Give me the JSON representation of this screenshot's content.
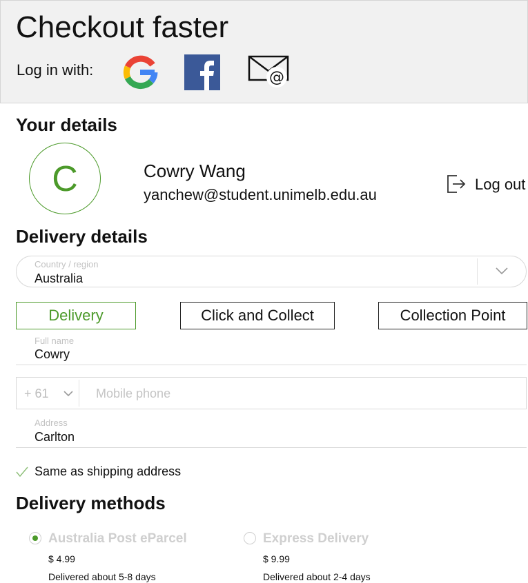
{
  "header": {
    "title": "Checkout faster",
    "login_label": "Log in with:",
    "providers": [
      {
        "name": "Google",
        "icon": "google-icon"
      },
      {
        "name": "Facebook",
        "icon": "facebook-icon"
      },
      {
        "name": "Email",
        "icon": "email-icon"
      }
    ]
  },
  "your_details": {
    "heading": "Your details",
    "avatar_initial": "C",
    "name": "Cowry Wang",
    "email": "yanchew@student.unimelb.edu.au",
    "logout_label": "Log out",
    "logout_icon": "logout-icon"
  },
  "delivery_details": {
    "heading": "Delivery details",
    "country": {
      "label": "Country / region",
      "value": "Australia",
      "icon": "chevron-down-icon"
    },
    "tabs": [
      {
        "label": "Delivery",
        "active": true
      },
      {
        "label": "Click and Collect",
        "active": false
      },
      {
        "label": "Collection Point",
        "active": false
      }
    ],
    "full_name": {
      "label": "Full name",
      "value": "Cowry"
    },
    "phone": {
      "country_code": "+ 61",
      "placeholder": "Mobile phone"
    },
    "address": {
      "label": "Address",
      "value": "Carlton"
    },
    "same_as_shipping": {
      "label": "Same as shipping address",
      "checked": true
    }
  },
  "delivery_methods": {
    "heading": "Delivery methods",
    "options": [
      {
        "name": "Australia Post eParcel",
        "price": "$ 4.99",
        "eta": "Delivered about 5-8 days",
        "selected": true
      },
      {
        "name": "Express Delivery",
        "price": "$ 9.99",
        "eta": "Delivered about 2-4 days",
        "selected": false
      }
    ]
  },
  "colors": {
    "accent": "#4c9a2a",
    "header_bg": "#f1f1f1",
    "border": "#d9d9d9",
    "muted_text": "#c2c2c2",
    "facebook_blue": "#3b5998"
  }
}
